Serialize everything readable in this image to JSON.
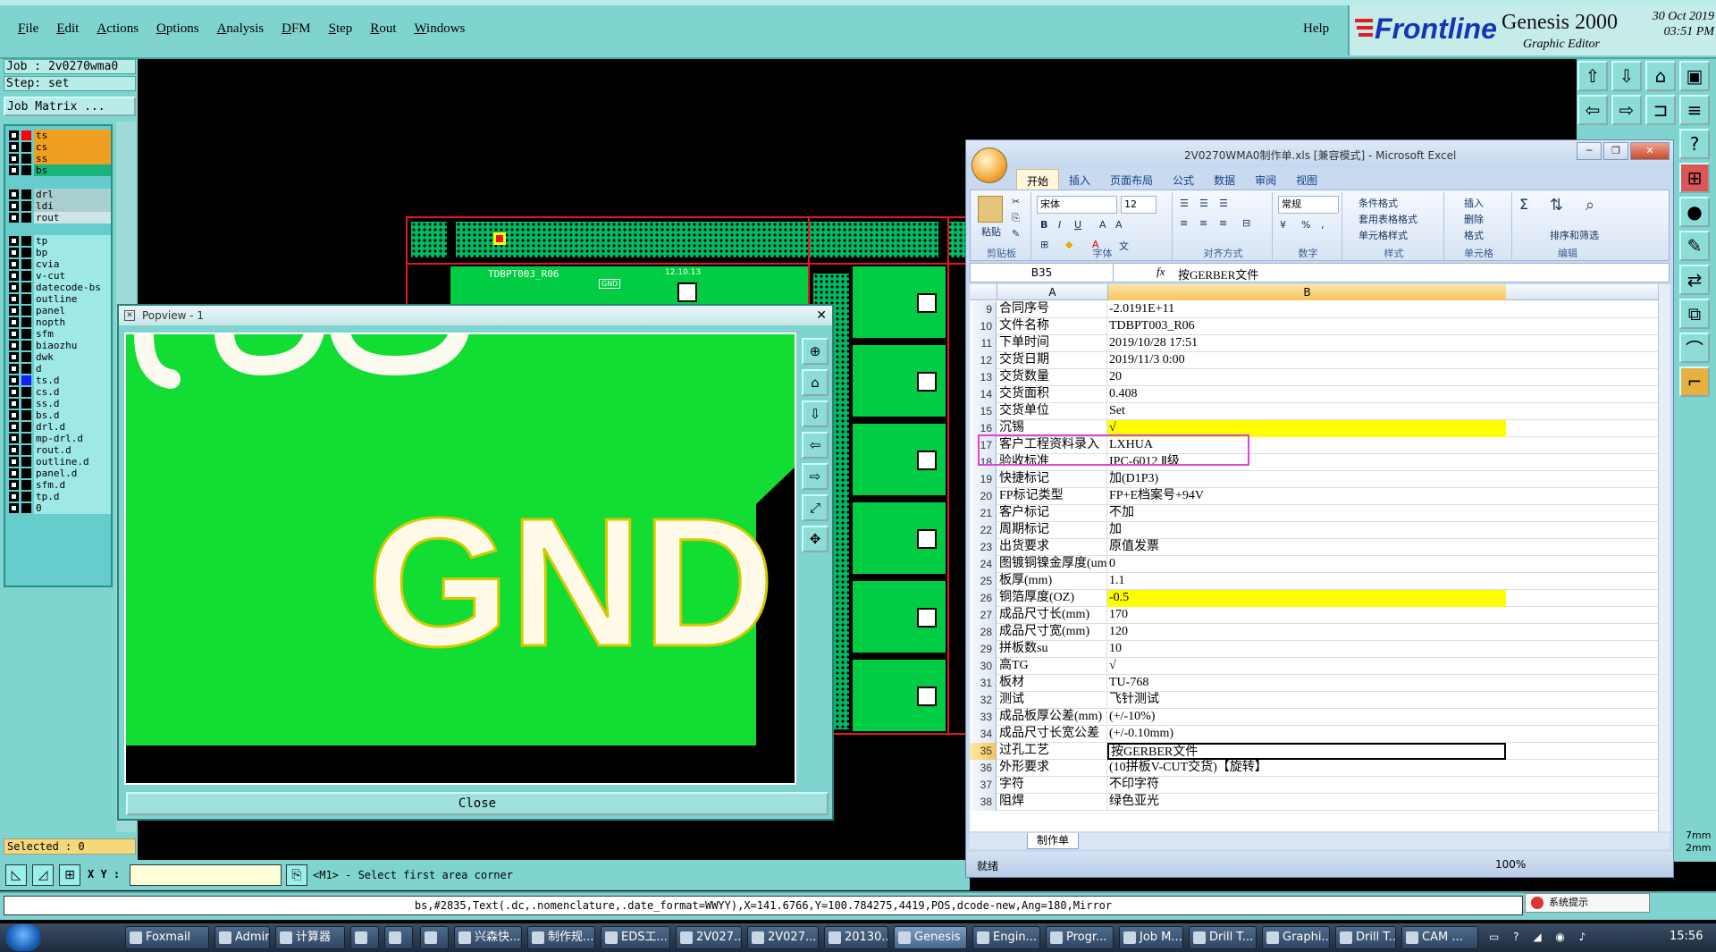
{
  "menubar": {
    "items": [
      "File",
      "Edit",
      "Actions",
      "Options",
      "Analysis",
      "DFM",
      "Step",
      "Rout",
      "Windows"
    ],
    "help": "Help"
  },
  "brand": {
    "name": "Frontline",
    "product": "Genesis 2000",
    "subtitle": "Graphic Editor",
    "date": "30 Oct 2019",
    "time": "03:51 PM"
  },
  "left": {
    "job": "Job : 2v0270wma0",
    "step": "Step: set",
    "job_matrix": "Job Matrix ...",
    "selected": "Selected : 0",
    "layers": [
      {
        "name": "ts",
        "color": "#f0a020",
        "swatch": "#ff0000"
      },
      {
        "name": "cs",
        "color": "#f0a020",
        "swatch": "#000000"
      },
      {
        "name": "ss",
        "color": "#f0a020",
        "swatch": "#000000"
      },
      {
        "name": "bs",
        "color": "#1bb37a",
        "swatch": "#000000"
      },
      {
        "name": "drl",
        "color": "#a8cfd0",
        "swatch": "#000000"
      },
      {
        "name": "ldi",
        "color": "#a8cfd0",
        "swatch": "#000000"
      },
      {
        "name": "rout",
        "color": "#cfe4e4",
        "swatch": "#000000"
      },
      {
        "name": "tp",
        "color": "#9ee8e8",
        "swatch": "#000000"
      },
      {
        "name": "bp",
        "color": "#9ee8e8",
        "swatch": "#000000"
      },
      {
        "name": "cvia",
        "color": "#9ee8e8",
        "swatch": "#000000"
      },
      {
        "name": "v-cut",
        "color": "#9ee8e8",
        "swatch": "#000000"
      },
      {
        "name": "datecode-bs",
        "color": "#9ee8e8",
        "swatch": "#000000"
      },
      {
        "name": "outline",
        "color": "#9ee8e8",
        "swatch": "#000000"
      },
      {
        "name": "panel",
        "color": "#9ee8e8",
        "swatch": "#000000"
      },
      {
        "name": "nopth",
        "color": "#9ee8e8",
        "swatch": "#000000"
      },
      {
        "name": "sfm",
        "color": "#9ee8e8",
        "swatch": "#000000"
      },
      {
        "name": "biaozhu",
        "color": "#9ee8e8",
        "swatch": "#000000"
      },
      {
        "name": "dwk",
        "color": "#9ee8e8",
        "swatch": "#000000"
      },
      {
        "name": "d",
        "color": "#9ee8e8",
        "swatch": "#000000"
      },
      {
        "name": "ts.d",
        "color": "#9ee8e8",
        "swatch": "#1a1aff"
      },
      {
        "name": "cs.d",
        "color": "#9ee8e8",
        "swatch": "#000000"
      },
      {
        "name": "ss.d",
        "color": "#9ee8e8",
        "swatch": "#000000"
      },
      {
        "name": "bs.d",
        "color": "#9ee8e8",
        "swatch": "#000000"
      },
      {
        "name": "drl.d",
        "color": "#9ee8e8",
        "swatch": "#000000"
      },
      {
        "name": "mp-drl.d",
        "color": "#9ee8e8",
        "swatch": "#000000"
      },
      {
        "name": "rout.d",
        "color": "#9ee8e8",
        "swatch": "#000000"
      },
      {
        "name": "outline.d",
        "color": "#9ee8e8",
        "swatch": "#000000"
      },
      {
        "name": "panel.d",
        "color": "#9ee8e8",
        "swatch": "#000000"
      },
      {
        "name": "sfm.d",
        "color": "#9ee8e8",
        "swatch": "#000000"
      },
      {
        "name": "tp.d",
        "color": "#9ee8e8",
        "swatch": "#000000"
      },
      {
        "name": "0",
        "color": "#9ee8e8",
        "swatch": "#000000"
      }
    ]
  },
  "board": {
    "label": "TDBPT003_R06",
    "gnd_small": "GND",
    "date_small": "12.10.13"
  },
  "popview": {
    "title": "Popview - 1",
    "gnd_text": "GND",
    "close": "Close"
  },
  "cmd": {
    "xy_label": "X Y :",
    "xy_value": "",
    "prompt": "<M1> - Select first area corner"
  },
  "status": {
    "text": "bs,#2835,Text(.dc,.nomenclature,.date_format=WWYY),X=141.6766,Y=100.784275,4419,POS,dcode-new,Ang=180,Mirror",
    "alert": "系统提示",
    "right_a": "7mm",
    "right_b": "2mm"
  },
  "excel": {
    "title": "2V0270WMA0制作单.xls [兼容模式] - Microsoft Excel",
    "tabs": [
      "开始",
      "插入",
      "页面布局",
      "公式",
      "数据",
      "审阅",
      "视图"
    ],
    "ribbon": {
      "paste": "粘贴",
      "clipboard": "剪贴板",
      "font_name": "宋体",
      "font_size": "12",
      "font_group": "字体",
      "align_group": "对齐方式",
      "number_format": "常规",
      "number_group": "数字",
      "cond_format": "条件格式",
      "table_format": "套用表格格式",
      "cell_style": "单元格样式",
      "style_group": "样式",
      "insert": "插入",
      "delete": "删除",
      "format": "格式",
      "cells_group": "单元格",
      "sort": "排序和筛选",
      "find": "查找和选择",
      "edit_group": "编辑"
    },
    "namebox": "B35",
    "fx": "fx",
    "formula": "按GERBER文件",
    "col_a": "A",
    "col_b": "B",
    "rows": [
      {
        "n": "9",
        "a": "合同序号",
        "b": "-2.0191E+11"
      },
      {
        "n": "10",
        "a": "文件名称",
        "b": "TDBPT003_R06"
      },
      {
        "n": "11",
        "a": "下单时间",
        "b": "2019/10/28 17:51"
      },
      {
        "n": "12",
        "a": "交货日期",
        "b": "2019/11/3 0:00"
      },
      {
        "n": "13",
        "a": "交货数量",
        "b": "20"
      },
      {
        "n": "14",
        "a": "交货面积",
        "b": "0.408"
      },
      {
        "n": "15",
        "a": "交货单位",
        "b": "Set"
      },
      {
        "n": "16",
        "a": "沉锡",
        "b": "√",
        "hl": true
      },
      {
        "n": "17",
        "a": "客户工程资料录入",
        "b": "LXHUA"
      },
      {
        "n": "18",
        "a": "验收标准",
        "b": "IPC-6012 Ⅱ级"
      },
      {
        "n": "19",
        "a": "快捷标记",
        "b": "加(D1P3)"
      },
      {
        "n": "20",
        "a": "FP标记类型",
        "b": "FP+E档案号+94V"
      },
      {
        "n": "21",
        "a": "客户标记",
        "b": "不加"
      },
      {
        "n": "22",
        "a": "周期标记",
        "b": "加"
      },
      {
        "n": "23",
        "a": "出货要求",
        "b": "原值发票"
      },
      {
        "n": "24",
        "a": "图镀铜镍金厚度(um)",
        "b": "0"
      },
      {
        "n": "25",
        "a": "板厚(mm)",
        "b": "1.1"
      },
      {
        "n": "26",
        "a": "铜箔厚度(OZ)",
        "b": "-0.5",
        "hl": true
      },
      {
        "n": "27",
        "a": "成品尺寸长(mm)",
        "b": "170"
      },
      {
        "n": "28",
        "a": "成品尺寸宽(mm)",
        "b": "120"
      },
      {
        "n": "29",
        "a": "拼板数su",
        "b": "10"
      },
      {
        "n": "30",
        "a": "高TG",
        "b": "√"
      },
      {
        "n": "31",
        "a": "板材",
        "b": "TU-768"
      },
      {
        "n": "32",
        "a": "测试",
        "b": "飞针测试"
      },
      {
        "n": "33",
        "a": "成品板厚公差(mm)",
        "b": "(+/-10%)"
      },
      {
        "n": "34",
        "a": "成品尺寸长宽公差",
        "b": "(+/-0.10mm)"
      },
      {
        "n": "35",
        "a": "过孔工艺",
        "b": "按GERBER文件",
        "sel": true
      },
      {
        "n": "36",
        "a": "外形要求",
        "b": "(10拼板V-CUT交货)【旋转】"
      },
      {
        "n": "37",
        "a": "字符",
        "b": "不印字符"
      },
      {
        "n": "38",
        "a": "阻焊",
        "b": "绿色亚光"
      }
    ],
    "sheet_tab": "制作单",
    "status_ready": "就绪",
    "zoom": "100%"
  },
  "taskbar": {
    "items": [
      "Foxmail",
      "Admin...",
      "计算器",
      "",
      "",
      "",
      "兴森快...",
      "制作规...",
      "EDS工...",
      "2V027...",
      "2V027...",
      "20130...",
      "Genesis",
      "Engin...",
      "Progr...",
      "Job M...",
      "Drill T...",
      "Graphi...",
      "Drill T...",
      "CAM ..."
    ],
    "clock": "15:56"
  }
}
